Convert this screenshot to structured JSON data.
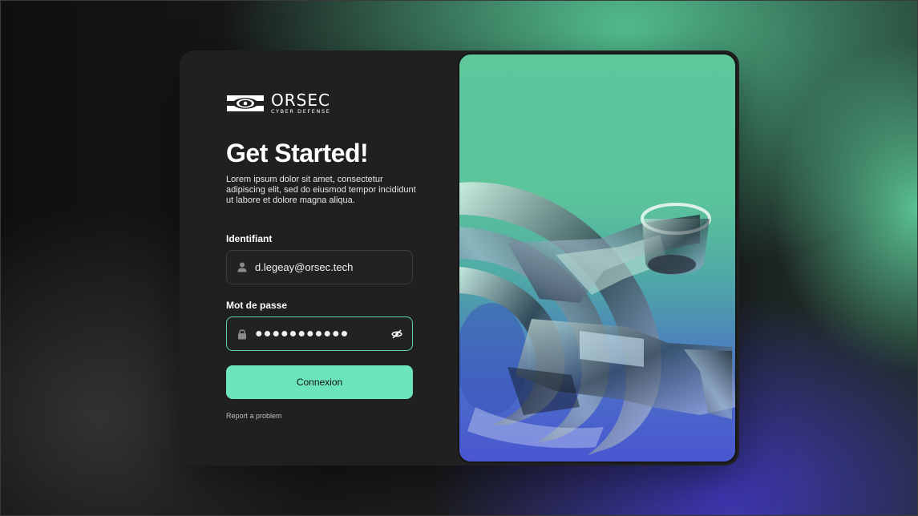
{
  "brand": {
    "name": "ORSEC",
    "tagline": "CYBER DEFENSE"
  },
  "login": {
    "title": "Get Started!",
    "description": "Lorem ipsum dolor sit amet, consectetur adipiscing elit, sed do eiusmod tempor incididunt ut labore et dolore magna aliqua.",
    "username_label": "Identifiant",
    "username_value": "d.legeay@orsec.tech",
    "password_label": "Mot de passe",
    "password_value": "●●●●●●●●●●●",
    "submit_label": "Connexion",
    "report_link": "Report a problem"
  },
  "icons": {
    "user": "user-icon",
    "lock": "lock-icon",
    "toggle_visibility": "eye-off-icon",
    "logo": "orsec-eye-logo"
  },
  "colors": {
    "accent": "#6ce4bd",
    "card": "#202020",
    "focus_border": "#5fd2a6"
  }
}
